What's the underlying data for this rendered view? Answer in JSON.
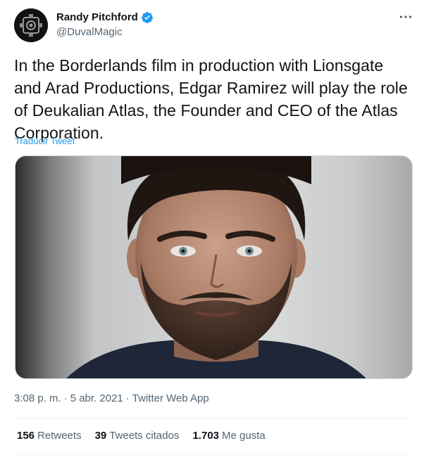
{
  "author": {
    "name": "Randy Pitchford",
    "handle": "@DuvalMagic",
    "verified": true
  },
  "tweet": {
    "text": "In the Borderlands film in production with Lionsgate and Arad Productions, Edgar Ramirez will play the role of Deukalian Atlas, the Founder and CEO of the Atlas Corporation.",
    "translate_label": "Traducir Tweet",
    "time": "3:08 p. m.",
    "date": "5 abr. 2021",
    "separator": "·",
    "source": "Twitter Web App"
  },
  "stats": {
    "retweets_count": "156",
    "retweets_label": "Retweets",
    "quotes_count": "39",
    "quotes_label": "Tweets citados",
    "likes_count": "1.703",
    "likes_label": "Me gusta"
  },
  "icons": {
    "avatar": "gear-logo-icon",
    "verified": "verified-badge-icon",
    "more": "more-options-icon"
  },
  "colors": {
    "accent": "#1d9bf0",
    "text_primary": "#0f1419",
    "text_secondary": "#536471",
    "divider": "#eff3f4"
  }
}
